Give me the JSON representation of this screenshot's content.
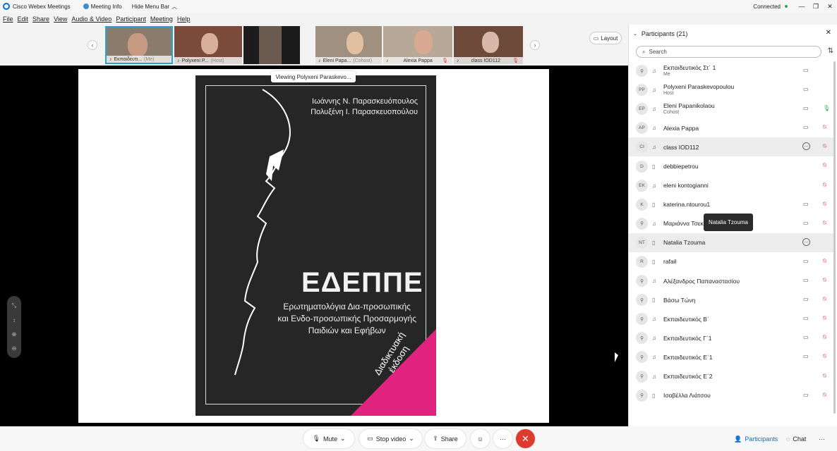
{
  "titlebar": {
    "app_title": "Cisco Webex Meetings",
    "meeting_info": "Meeting Info",
    "hide_menu": "Hide Menu Bar",
    "status": "Connected",
    "minimize": "—",
    "restore": "❐",
    "close": "✕"
  },
  "menu": [
    "File",
    "Edit",
    "Share",
    "View",
    "Audio & Video",
    "Participant",
    "Meeting",
    "Help"
  ],
  "thumbnails": [
    {
      "name": "Εκπαιδευτι...",
      "tag": "(Me)",
      "bg": "#8a7b6b"
    },
    {
      "name": "Polyxeni P...",
      "tag": "(Host)",
      "bg": "#7a4a3a"
    },
    {
      "name": "",
      "tag": "",
      "bg": "#3a3030"
    },
    {
      "name": "Eleni Papa...",
      "tag": "(Cohost)",
      "bg": "#a09080"
    },
    {
      "name": "Alexia Pappa",
      "tag": "",
      "bg": "#b8a898"
    },
    {
      "name": "class IOD112",
      "tag": "",
      "bg": "#6d4a3a"
    }
  ],
  "layout_label": "Layout",
  "viewing_label": "Viewing Polyxeni Paraskevo...",
  "book": {
    "author1": "Ιωάννης Ν. Παρασκευόπουλος",
    "author2": "Πολυξένη Ι. Παρασκευοπούλου",
    "title": "ΕΔΕΠΠΕ",
    "subtitle1": "Ερωτηματολόγια Δια-προσωπικής",
    "subtitle2": "και Ενδο-προσωπικής Προσαρμογής",
    "subtitle3": "Παιδιών και Εφήβων",
    "ribbon1": "Διαδικτυακή",
    "ribbon2": "έκδοση"
  },
  "controls": {
    "mute": "Mute",
    "stop_video": "Stop video",
    "share": "Share",
    "participants_tab": "Participants",
    "chat_tab": "Chat"
  },
  "panel": {
    "title": "Participants (21)",
    "search_placeholder": "Search",
    "tooltip": "Natalia Tzouma"
  },
  "participants": [
    {
      "initials": "",
      "name": "Εκπαιδευτικός Στ΄ 1",
      "role": "Me",
      "device": "audio",
      "video": true,
      "chat": false,
      "mic": "none"
    },
    {
      "initials": "PP",
      "name": "Polyxeni Paraskevopoulou",
      "role": "Host",
      "device": "audio",
      "video": true,
      "chat": false,
      "mic": "none"
    },
    {
      "initials": "EP",
      "name": "Eleni Papanikolaou",
      "role": "Cohost",
      "device": "audio",
      "video": true,
      "chat": false,
      "mic": "on"
    },
    {
      "initials": "AP",
      "name": "Alexia Pappa",
      "role": "",
      "device": "audio",
      "video": true,
      "chat": false,
      "mic": "muted"
    },
    {
      "initials": "CI",
      "name": "class IOD112",
      "role": "",
      "device": "audio",
      "video": false,
      "chat": true,
      "mic": "muted"
    },
    {
      "initials": "D",
      "name": "debbiepetrou",
      "role": "",
      "device": "phone",
      "video": false,
      "chat": false,
      "mic": "muted"
    },
    {
      "initials": "EK",
      "name": "eleni kontogianni",
      "role": "",
      "device": "audio",
      "video": false,
      "chat": false,
      "mic": "muted"
    },
    {
      "initials": "K",
      "name": "katerina.ntourou1",
      "role": "",
      "device": "phone",
      "video": true,
      "chat": false,
      "mic": "muted"
    },
    {
      "initials": "",
      "name": "Μαριάννα Τσεκ",
      "role": "",
      "device": "audio",
      "video": true,
      "chat": false,
      "mic": "muted"
    },
    {
      "initials": "NT",
      "name": "Natalia Tzouma",
      "role": "",
      "device": "phone",
      "video": false,
      "chat": true,
      "mic": "none"
    },
    {
      "initials": "R",
      "name": "rafail",
      "role": "",
      "device": "phone",
      "video": true,
      "chat": false,
      "mic": "muted"
    },
    {
      "initials": "",
      "name": "Αλέξανδρος Παπαναστασίου",
      "role": "",
      "device": "audio",
      "video": true,
      "chat": false,
      "mic": "muted"
    },
    {
      "initials": "",
      "name": "Βάσω Τώνη",
      "role": "",
      "device": "phone",
      "video": true,
      "chat": false,
      "mic": "muted"
    },
    {
      "initials": "",
      "name": "Εκπαιδευτικός Β΄",
      "role": "",
      "device": "audio",
      "video": true,
      "chat": false,
      "mic": "muted"
    },
    {
      "initials": "",
      "name": "Εκπαιδευτικός Γ΄1",
      "role": "",
      "device": "audio",
      "video": true,
      "chat": false,
      "mic": "muted"
    },
    {
      "initials": "",
      "name": "Εκπαιδευτικός Ε΄1",
      "role": "",
      "device": "audio",
      "video": true,
      "chat": false,
      "mic": "muted"
    },
    {
      "initials": "",
      "name": "Εκπαιδευτικός Ε΄2",
      "role": "",
      "device": "audio",
      "video": false,
      "chat": false,
      "mic": "muted"
    },
    {
      "initials": "",
      "name": "Ισαβέλλα Λιάτσου",
      "role": "",
      "device": "phone",
      "video": true,
      "chat": false,
      "mic": "muted"
    }
  ],
  "colors": {
    "accent": "#0a6ed1",
    "end_call": "#e0392f",
    "muted": "#d9383a",
    "unmuted": "#2fa84f"
  }
}
